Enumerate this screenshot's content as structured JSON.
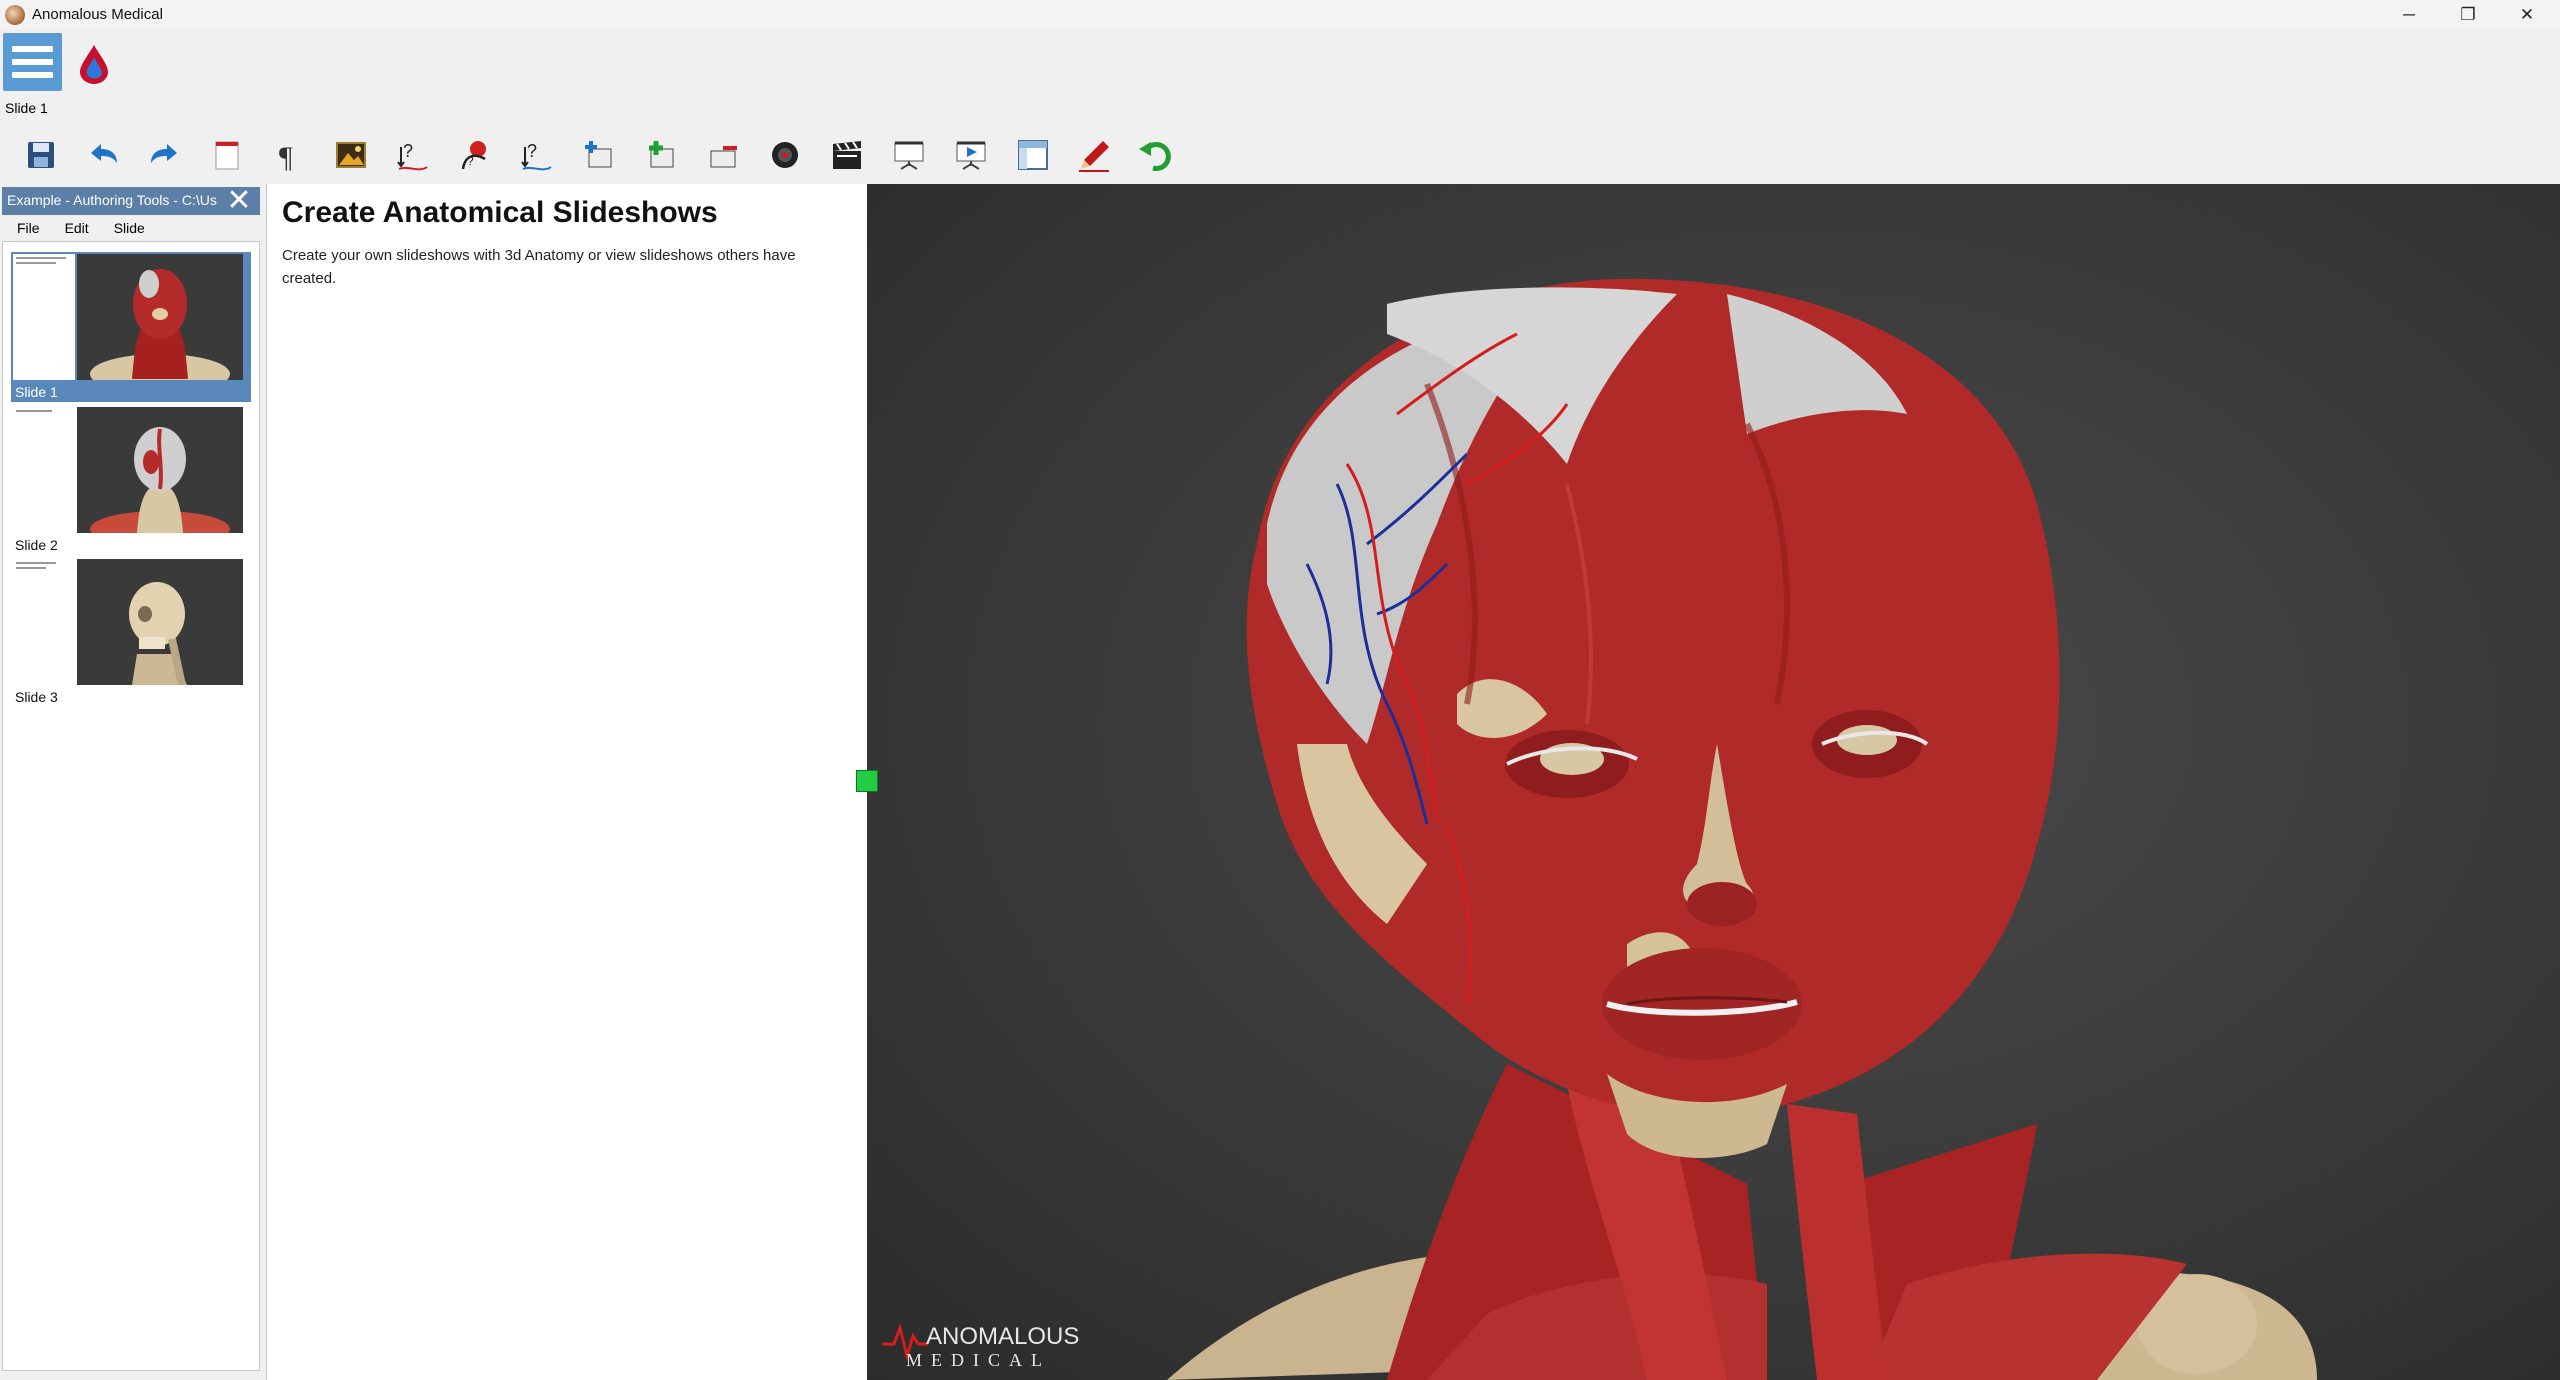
{
  "window": {
    "title": "Anomalous Medical",
    "minimize_glyph": "─",
    "maximize_glyph": "❐",
    "close_glyph": "✕"
  },
  "ribbon": {
    "current_slide_caption": "Slide 1",
    "toolbar_icons": [
      "save-icon",
      "undo-icon",
      "redo-icon",
      "new-slide-icon",
      "paragraph-icon",
      "insert-image-icon",
      "add-link-icon",
      "add-button-icon",
      "add-action-icon",
      "add-layer-icon",
      "add-item-icon",
      "remove-item-icon",
      "record-icon",
      "clapperboard-icon",
      "present-icon",
      "play-presentation-icon",
      "layout-icon",
      "annotate-pen-icon",
      "reset-icon"
    ]
  },
  "slides_panel": {
    "header": "Example - Authoring Tools - C:\\Us",
    "close_glyph": "✕",
    "menu": [
      "File",
      "Edit",
      "Slide"
    ],
    "slides": [
      {
        "label": "Slide 1",
        "selected": true,
        "preview": "head-muscles-front"
      },
      {
        "label": "Slide 2",
        "selected": false,
        "preview": "head-muscles-back"
      },
      {
        "label": "Slide 3",
        "selected": false,
        "preview": "skull-side"
      }
    ]
  },
  "document": {
    "title": "Create Anatomical Slideshows",
    "body": "Create your own slideshows with 3d Anatomy or view slideshows others have created."
  },
  "viewport": {
    "scene": "3d-head-muscles-anatomy",
    "brand": "ANOMALOUS",
    "brand_sub": "MEDICAL"
  },
  "colors": {
    "accent": "#5b9bd5",
    "panel_header": "#5b7fa6",
    "selected_slide": "#5b88bb",
    "muscle": "#b52a2a",
    "splitter": "#22cc44"
  }
}
